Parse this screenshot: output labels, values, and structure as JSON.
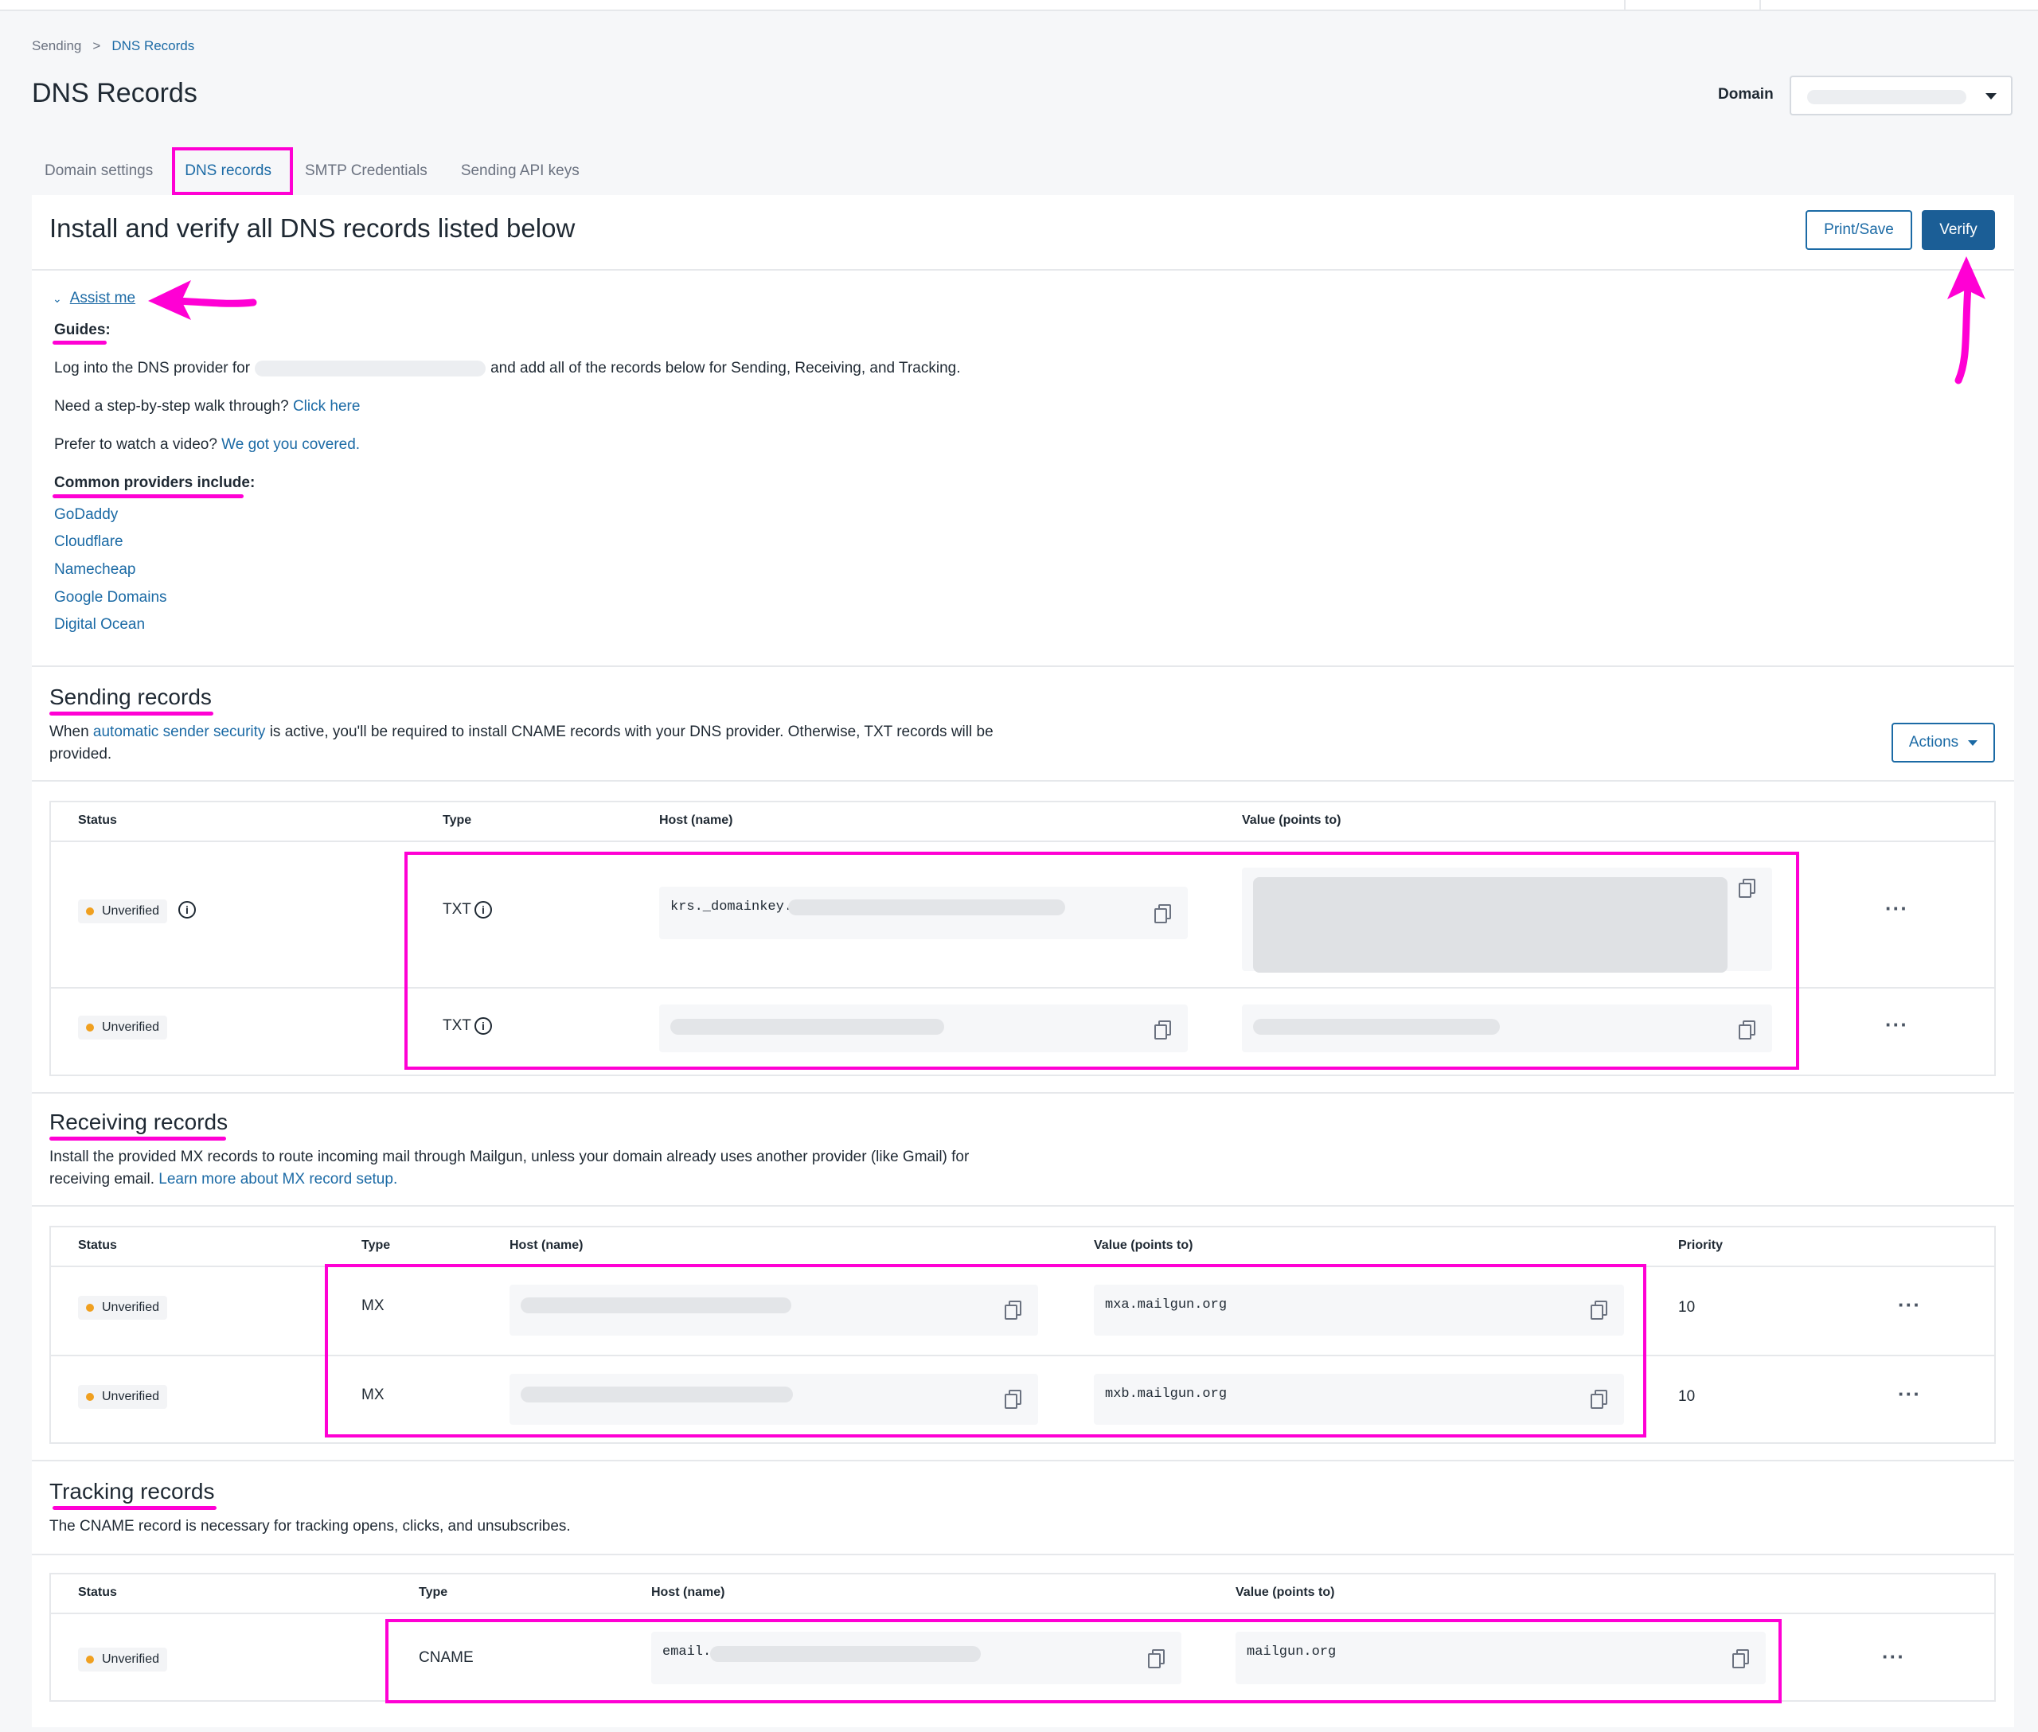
{
  "breadcrumb": {
    "parent": "Sending",
    "separator": ">",
    "current": "DNS Records"
  },
  "page_title": "DNS Records",
  "domain": {
    "label": "Domain",
    "value": ""
  },
  "tabs": [
    {
      "label": "Domain settings"
    },
    {
      "label": "DNS records",
      "active": true
    },
    {
      "label": "SMTP Credentials"
    },
    {
      "label": "Sending API keys"
    }
  ],
  "install": {
    "title": "Install and verify all DNS records listed below",
    "print_label": "Print/Save",
    "verify_label": "Verify"
  },
  "assist": {
    "toggle_label": "Assist me",
    "guides_title": "Guides:",
    "line1_pre": "Log into the DNS provider for",
    "line1_post": "and add all of the records below for Sending, Receiving, and Tracking.",
    "line2_pre": "Need a step-by-step walk through?",
    "line2_link": "Click here",
    "line3_pre": "Prefer to watch a video?",
    "line3_link": "We got you covered.",
    "providers_title": "Common providers include:",
    "providers": [
      "GoDaddy",
      "Cloudflare",
      "Namecheap",
      "Google Domains",
      "Digital Ocean"
    ]
  },
  "sending": {
    "title": "Sending records",
    "desc_pre": "When",
    "desc_link": "automatic sender security",
    "desc_post": "is active, you'll be required to install CNAME records with your DNS provider. Otherwise, TXT records will be provided.",
    "actions_label": "Actions",
    "headers": {
      "status": "Status",
      "type": "Type",
      "host": "Host (name)",
      "value": "Value (points to)"
    },
    "rows": [
      {
        "status": "Unverified",
        "type": "TXT",
        "host": "krs._domainkey.",
        "value": ""
      },
      {
        "status": "Unverified",
        "type": "TXT",
        "host": "",
        "value": ""
      }
    ]
  },
  "receiving": {
    "title": "Receiving records",
    "desc_pre": "Install the provided MX records to route incoming mail through Mailgun, unless your domain already uses another provider (like Gmail) for receiving email.",
    "desc_link": "Learn more about MX record setup.",
    "headers": {
      "status": "Status",
      "type": "Type",
      "host": "Host (name)",
      "value": "Value (points to)",
      "priority": "Priority"
    },
    "rows": [
      {
        "status": "Unverified",
        "type": "MX",
        "host": "",
        "value": "mxa.mailgun.org",
        "priority": "10"
      },
      {
        "status": "Unverified",
        "type": "MX",
        "host": "",
        "value": "mxb.mailgun.org",
        "priority": "10"
      }
    ]
  },
  "tracking": {
    "title": "Tracking records",
    "desc": "The CNAME record is necessary for tracking opens, clicks, and unsubscribes.",
    "headers": {
      "status": "Status",
      "type": "Type",
      "host": "Host (name)",
      "value": "Value (points to)"
    },
    "rows": [
      {
        "status": "Unverified",
        "type": "CNAME",
        "host": "email.",
        "value": "mailgun.org"
      }
    ]
  },
  "icons": {
    "more": "more-horizontal-icon",
    "copy": "copy-icon",
    "info": "info-icon",
    "caret": "caret-down-icon",
    "chevron": "chevron-down-icon"
  },
  "colors": {
    "accent": "#1b6aa5",
    "primary_button": "#1b5e96",
    "annotation": "#ff00d4",
    "status_dot": "#f0a020"
  }
}
